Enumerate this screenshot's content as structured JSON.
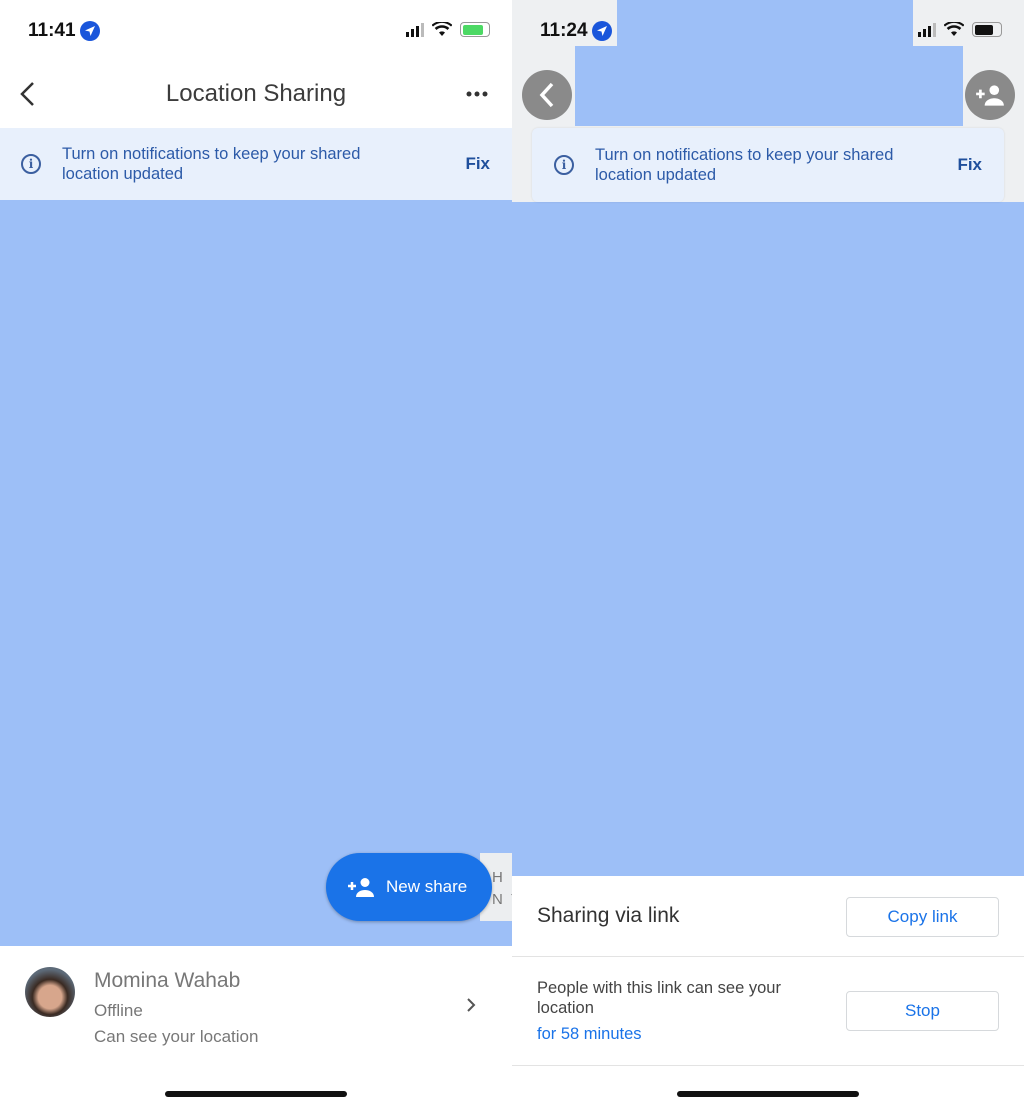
{
  "left": {
    "status_time": "11:41",
    "header": {
      "title": "Location Sharing"
    },
    "banner": {
      "text": "Turn on notifications to keep your shared location updated",
      "action": "Fix"
    },
    "new_share_label": "New share",
    "map_label_fragment": "H E\nN Y",
    "contact": {
      "name": "Momina Wahab",
      "status": "Offline",
      "permission": "Can see your location"
    }
  },
  "right": {
    "status_time": "11:24",
    "banner": {
      "text": "Turn on notifications to keep your shared location updated",
      "action": "Fix"
    },
    "sheet": {
      "title": "Sharing via link",
      "copy_label": "Copy link",
      "description": "People with this link can see your location",
      "duration": "for 58 minutes",
      "stop_label": "Stop"
    }
  },
  "colors": {
    "accent": "#1a73e8",
    "map_redaction": "#9dbff7",
    "banner_bg": "#e8f0fc",
    "battery_charging": "#4cd964"
  },
  "icons": [
    "back-icon",
    "more-icon",
    "info-icon",
    "add-person-icon",
    "chevron-right-icon",
    "location-arrow-icon",
    "signal-icon",
    "wifi-icon",
    "battery-icon"
  ]
}
